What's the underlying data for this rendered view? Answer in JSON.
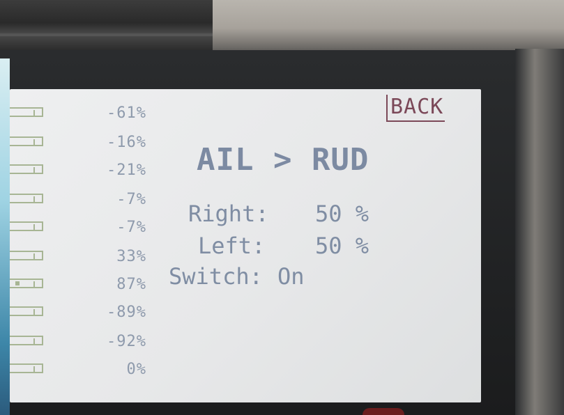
{
  "screen": {
    "back_label": "BACK",
    "title": "AIL > RUD",
    "rows": [
      {
        "label": "Right:",
        "value": "50 %"
      },
      {
        "label": "Left:",
        "value": "50 %"
      },
      {
        "label": "Switch:",
        "value": "On"
      }
    ],
    "channel_percentages": [
      "-61%",
      "-16%",
      "-21%",
      "-7%",
      "-7%",
      "33%",
      "87%",
      "-89%",
      "-92%",
      "0%"
    ]
  },
  "colors": {
    "lcd_background": "#e8e9ea",
    "lcd_text": "#7f8da3",
    "back_button": "#7b4858",
    "bar_outline": "#a7b594"
  }
}
